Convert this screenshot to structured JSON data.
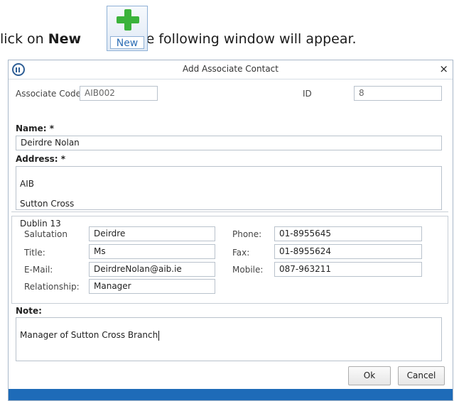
{
  "intro": {
    "prefix": "lick on ",
    "bold": "New",
    "suffix": " the following window will appear.",
    "new_button_label": "New",
    "new_button_icon": "green-plus-icon"
  },
  "window": {
    "title": "Add Associate Contact",
    "close_glyph": "×",
    "app_icon": "building-icon",
    "footer_color": "#1e6bb8"
  },
  "form": {
    "associate_code_label": "Associate Code",
    "associate_code_value": "AIB002",
    "id_label": "ID",
    "id_value": "8",
    "name_label": "Name: *",
    "name_value": "Deirdre Nolan",
    "address_label": "Address: *",
    "address_lines": [
      "AIB",
      "Sutton Cross",
      "Dublin 13"
    ],
    "salutation_label": "Salutation",
    "salutation_value": "Deirdre",
    "title_label": "Title:",
    "title_value": "Ms",
    "email_label": "E-Mail:",
    "email_value": "DeirdreNolan@aib.ie",
    "relationship_label": "Relationship:",
    "relationship_value": "Manager",
    "phone_label": "Phone:",
    "phone_value": "01-8955645",
    "fax_label": "Fax:",
    "fax_value": "01-8955624",
    "mobile_label": "Mobile:",
    "mobile_value": "087-963211",
    "note_label": "Note:",
    "note_value": "Manager of Sutton Cross Branch"
  },
  "buttons": {
    "ok": "Ok",
    "cancel": "Cancel"
  }
}
